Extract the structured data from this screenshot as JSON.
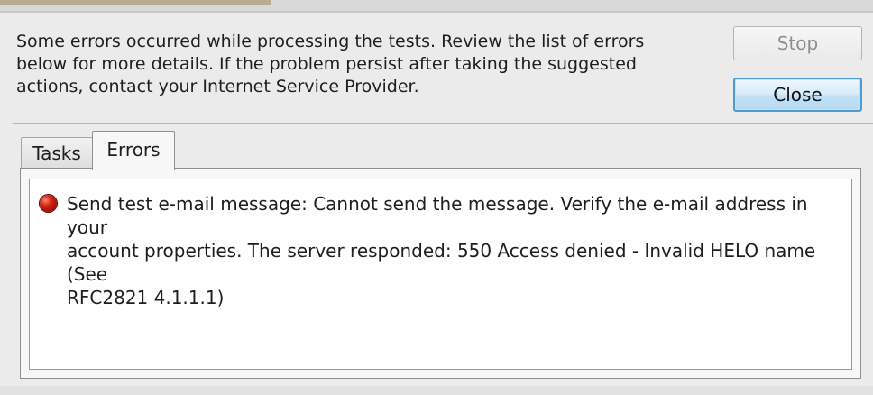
{
  "dialog": {
    "message": "Some errors occurred while processing the tests. Review the list of errors\nbelow for more details. If the problem persist after taking the suggested\nactions, contact your Internet Service Provider.",
    "buttons": {
      "stop_label": "Stop",
      "close_label": "Close"
    }
  },
  "tabs": [
    {
      "label": "Tasks"
    },
    {
      "label": "Errors"
    }
  ],
  "errors": [
    {
      "icon": "error-icon",
      "text": "Send test e-mail message: Cannot send the message. Verify the e-mail address in your\naccount properties.  The server responded: 550 Access denied - Invalid HELO name (See\nRFC2821 4.1.1.1)"
    }
  ],
  "colors": {
    "close_button_border": "#4e9ad2",
    "error_icon": "#d32515",
    "dialog_background": "#ebebeb"
  }
}
